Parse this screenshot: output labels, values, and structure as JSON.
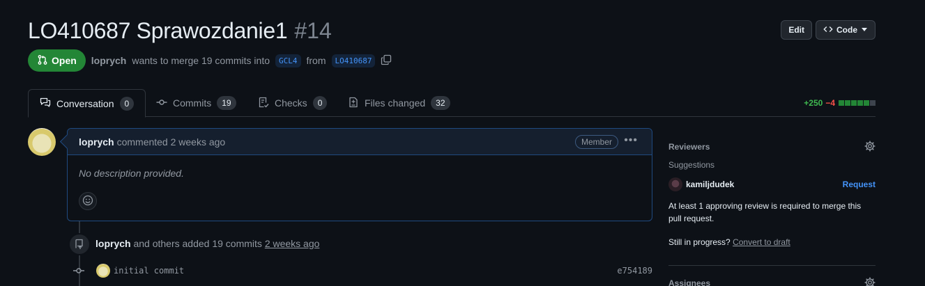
{
  "header": {
    "title": "LO410687 Sprawozdanie1",
    "number": "#14",
    "edit_label": "Edit",
    "code_label": "Code"
  },
  "state": {
    "badge_label": "Open",
    "author": "loprych",
    "merge_text": "wants to merge 19 commits into",
    "base_branch": "GCL4",
    "from_text": "from",
    "head_branch": "LO410687"
  },
  "tabs": [
    {
      "label": "Conversation",
      "count": "0",
      "icon": "comment-discussion-icon"
    },
    {
      "label": "Commits",
      "count": "19",
      "icon": "git-commit-icon"
    },
    {
      "label": "Checks",
      "count": "0",
      "icon": "checklist-icon"
    },
    {
      "label": "Files changed",
      "count": "32",
      "icon": "file-diff-icon"
    }
  ],
  "diffstat": {
    "additions": "+250",
    "deletions": "−4",
    "blocks": [
      "green",
      "green",
      "green",
      "green",
      "green",
      "grey"
    ]
  },
  "comment": {
    "author": "loprych",
    "meta": "commented 2 weeks ago",
    "badge": "Member",
    "body": "No description provided."
  },
  "timeline": {
    "event_author": "loprych",
    "event_text": "and others added 19 commits",
    "event_when": "2 weeks ago",
    "commits": [
      {
        "message": "initial commit",
        "sha": "e754189"
      }
    ]
  },
  "sidebar": {
    "reviewers_heading": "Reviewers",
    "suggestions_label": "Suggestions",
    "suggested_reviewer": "kamiljdudek",
    "request_label": "Request",
    "review_note": "At least 1 approving review is required to merge this pull request.",
    "progress_prefix": "Still in progress?",
    "convert_link": "Convert to draft",
    "assignees_heading": "Assignees"
  },
  "colors": {
    "background": "#0d1117",
    "open_green": "#238636",
    "link_blue": "#4493f8",
    "additions": "#3fb950",
    "deletions": "#f85149"
  }
}
